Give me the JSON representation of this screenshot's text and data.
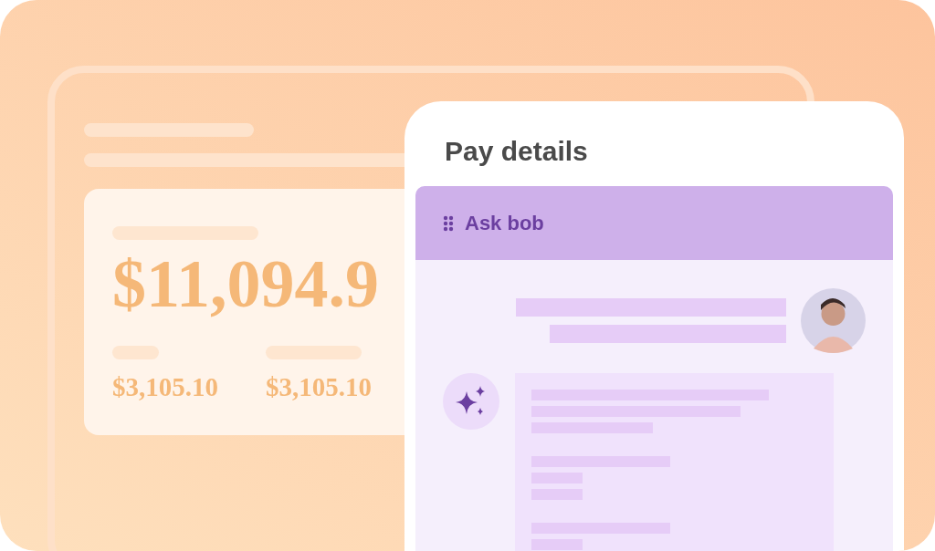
{
  "background_window": {
    "summary_card": {
      "amount": "$11,094.9",
      "sub_amounts": [
        "$3,105.10",
        "$3,105.10"
      ]
    }
  },
  "panel": {
    "title": "Pay details",
    "chat": {
      "title": "Ask bob"
    }
  }
}
